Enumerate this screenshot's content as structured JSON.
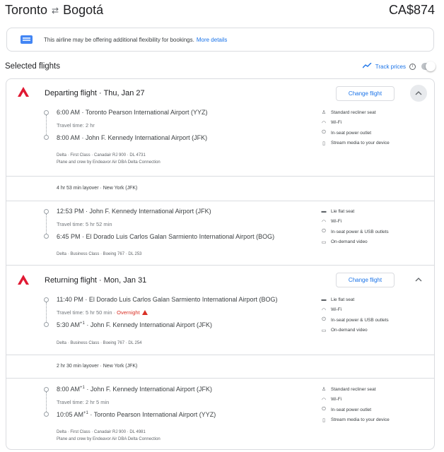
{
  "header": {
    "origin": "Toronto",
    "swap_icon": "⇄",
    "destination": "Bogotá",
    "price": "CA$874"
  },
  "notice": {
    "text": "This airline may be offering additional flexibility for bookings.",
    "link": "More details"
  },
  "selected": {
    "title": "Selected flights",
    "track_label": "Track prices",
    "track_enabled": false
  },
  "departing": {
    "title": "Departing flight · Thu, Jan 27",
    "change_label": "Change flight",
    "expand_icon": "chevron-up",
    "segments": [
      {
        "dep_time": "6:00 AM",
        "dep_airport": "Toronto Pearson International Airport (YYZ)",
        "travel_time": "Travel time: 2 hr",
        "arr_time": "8:00 AM",
        "arr_sup": "",
        "arr_airport": "John F. Kennedy International Airport (JFK)",
        "meta1": "Delta · First Class · Canadair RJ 900 · DL 4731",
        "meta2": "Plane and crew by Endeavor Air DBA Delta Connection",
        "amenities": [
          "Standard recliner seat",
          "Wi-Fi",
          "In-seat power outlet",
          "Stream media to your device"
        ]
      },
      {
        "dep_time": "12:53 PM",
        "dep_airport": "John F. Kennedy International Airport (JFK)",
        "travel_time": "Travel time: 5 hr 52 min",
        "arr_time": "6:45 PM",
        "arr_sup": "",
        "arr_airport": "El Dorado Luis Carlos Galan Sarmiento International Airport (BOG)",
        "meta1": "Delta · Business Class · Boeing 767 · DL 253",
        "meta2": "",
        "amenities": [
          "Lie flat seat",
          "Wi-Fi",
          "In-seat power & USB outlets",
          "On-demand video"
        ]
      }
    ],
    "layover": "4 hr 53 min layover · New York (JFK)"
  },
  "returning": {
    "title": "Returning flight · Mon, Jan 31",
    "change_label": "Change flight",
    "expand_icon": "chevron-up",
    "segments": [
      {
        "dep_time": "11:40 PM",
        "dep_airport": "El Dorado Luis Carlos Galan Sarmiento International Airport (BOG)",
        "travel_time": "Travel time: 5 hr 50 min",
        "overnight": "Overnight",
        "arr_time": "5:30 AM",
        "arr_sup": "+1",
        "arr_airport": "John F. Kennedy International Airport (JFK)",
        "meta1": "Delta · Business Class · Boeing 767 · DL 254",
        "meta2": "",
        "amenities": [
          "Lie flat seat",
          "Wi-Fi",
          "In-seat power & USB outlets",
          "On-demand video"
        ]
      },
      {
        "dep_time": "8:00 AM",
        "dep_sup": "+1",
        "dep_airport": "John F. Kennedy International Airport (JFK)",
        "travel_time": "Travel time: 2 hr 5 min",
        "arr_time": "10:05 AM",
        "arr_sup": "+1",
        "arr_airport": "Toronto Pearson International Airport (YYZ)",
        "meta1": "Delta · First Class · Canadair RJ 900 · DL 4981",
        "meta2": "Plane and crew by Endeavor Air DBA Delta Connection",
        "amenities": [
          "Standard recliner seat",
          "Wi-Fi",
          "In-seat power outlet",
          "Stream media to your device"
        ]
      }
    ],
    "layover": "2 hr 30 min layover · New York (JFK)"
  },
  "colors": {
    "accent": "#1a73e8",
    "delta_red": "#e01933",
    "warning": "#d93025"
  }
}
